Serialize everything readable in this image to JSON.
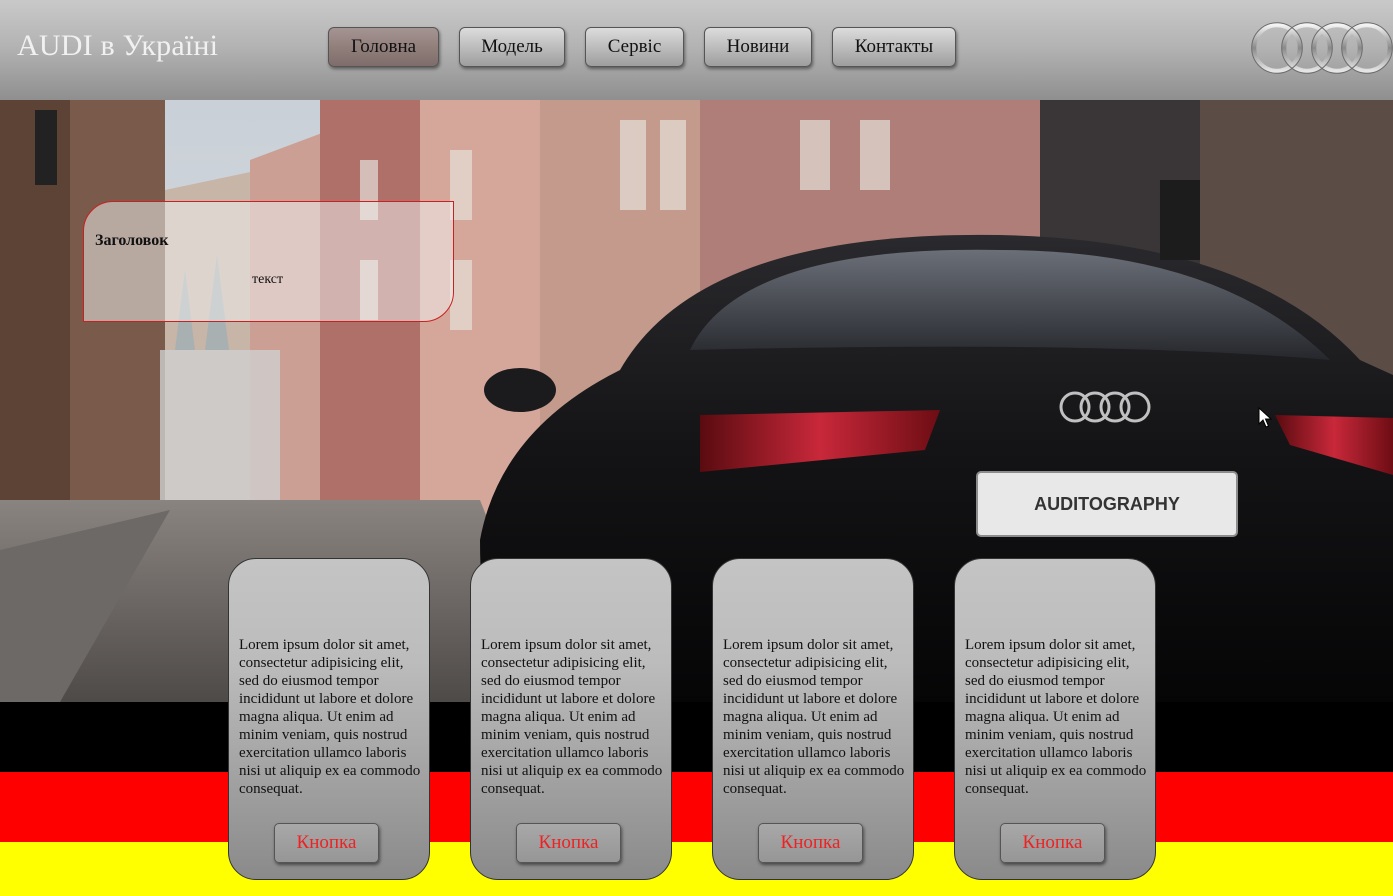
{
  "header": {
    "site_title": "AUDI в Україні",
    "nav": [
      {
        "label": "Головна",
        "active": true
      },
      {
        "label": "Модель",
        "active": false
      },
      {
        "label": "Сервіс",
        "active": false
      },
      {
        "label": "Новини",
        "active": false
      },
      {
        "label": "Контакты",
        "active": false
      }
    ],
    "logo_icon": "audi-rings-icon"
  },
  "hero": {
    "image": "black Audi sedan parked on a cobblestone old-town street",
    "plate_text": "AUDITOGRAPHY"
  },
  "info_box": {
    "title": "Заголовок",
    "text": "текст"
  },
  "cards": [
    {
      "text": "Lorem ipsum dolor sit amet, consectetur adipisicing elit, sed do eiusmod tempor incididunt ut labore et dolore magna aliqua. Ut enim ad minim veniam, quis nostrud exercitation ullamco laboris nisi ut aliquip ex ea commodo consequat.",
      "button_label": "Кнопка"
    },
    {
      "text": "Lorem ipsum dolor sit amet, consectetur adipisicing elit, sed do eiusmod tempor incididunt ut labore et dolore magna aliqua. Ut enim ad minim veniam, quis nostrud exercitation ullamco laboris nisi ut aliquip ex ea commodo consequat.",
      "button_label": "Кнопка"
    },
    {
      "text": "Lorem ipsum dolor sit amet, consectetur adipisicing elit, sed do eiusmod tempor incididunt ut labore et dolore magna aliqua. Ut enim ad minim veniam, quis nostrud exercitation ullamco laboris nisi ut aliquip ex ea commodo consequat.",
      "button_label": "Кнопка"
    },
    {
      "text": "Lorem ipsum dolor sit amet, consectetur adipisicing elit, sed do eiusmod tempor incididunt ut labore et dolore magna aliqua. Ut enim ad minim veniam, quis nostrud exercitation ullamco laboris nisi ut aliquip ex ea commodo consequat.",
      "button_label": "Кнопка"
    }
  ],
  "flag": {
    "colors": [
      "#000000",
      "#ff0000",
      "#ffff00"
    ]
  },
  "colors": {
    "header_bg": "#b4b4b4",
    "active_nav": "#927f7c",
    "card_button_text": "#ee2222",
    "info_box_border": "#cc1f1f"
  }
}
